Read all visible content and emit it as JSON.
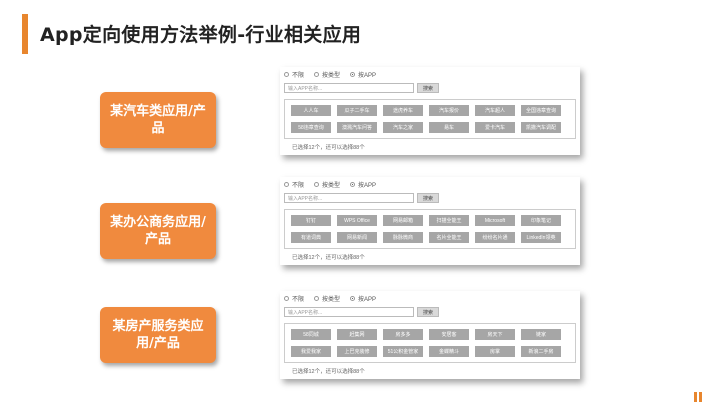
{
  "title": "App定向使用方法举例-行业相关应用",
  "panels": [
    {
      "label": "某汽车类应用/产品",
      "radios": [
        "不限",
        "按类型",
        "按APP"
      ],
      "search_placeholder": "输入APP名称...",
      "search_button": "搜索",
      "chips": [
        "人人车",
        "瓜子二手车",
        "途虎养车",
        "汽车报价",
        "汽车超人",
        "全国违章查询",
        "58违章查询",
        "澳溅汽车问答",
        "汽车之家",
        "易车",
        "爱卡汽车",
        "凯撒汽车调配"
      ],
      "status": "已选择12个，还可以选择88个"
    },
    {
      "label": "某办公商务应用/产品",
      "radios": [
        "不限",
        "按类型",
        "按APP"
      ],
      "search_placeholder": "输入APP名称...",
      "search_button": "搜索",
      "chips": [
        "钉钉",
        "WPS Office",
        "网易邮箱",
        "扫描全能王",
        "Microsoft",
        "印象笔记",
        "有道词典",
        "网易新闻",
        "脉脉微商",
        "名片全能王",
        "纷纷名片通",
        "LinkedIn领英"
      ],
      "status": "已选择12个，还可以选择88个"
    },
    {
      "label": "某房产服务类应用/产品",
      "radios": [
        "不限",
        "按类型",
        "按APP"
      ],
      "search_placeholder": "输入APP名称...",
      "search_button": "搜索",
      "chips": [
        "58同城",
        "赶集网",
        "房多多",
        "安居客",
        "房天下",
        "链家",
        "我爱我家",
        "上巴克装修",
        "51公积金管家",
        "金蝶精斗",
        "房掌",
        "新浪二手房"
      ],
      "status": "已选择12个，还可以选择88个"
    }
  ]
}
